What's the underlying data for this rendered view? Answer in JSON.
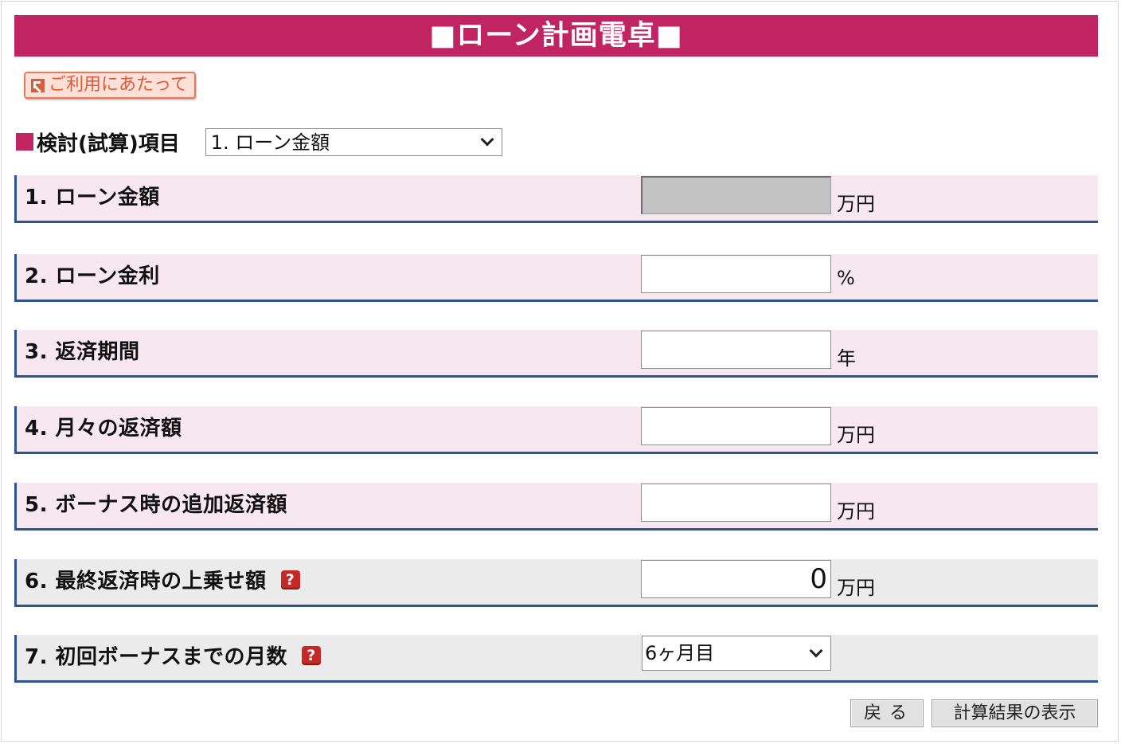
{
  "header": {
    "title": "■ローン計画電卓■"
  },
  "guide_link": {
    "label": "ご利用にあたって"
  },
  "calc_target": {
    "label": "検討(試算)項目",
    "selected": "1. ローン金額"
  },
  "rows": [
    {
      "label": "1. ローン金額",
      "value": "",
      "unit": "万円",
      "disabled": true
    },
    {
      "label": "2. ローン金利",
      "value": "",
      "unit": "%"
    },
    {
      "label": "3. 返済期間",
      "value": "",
      "unit": "年"
    },
    {
      "label": "4. 月々の返済額",
      "value": "",
      "unit": "万円"
    },
    {
      "label": "5. ボーナス時の追加返済額",
      "value": "",
      "unit": "万円"
    },
    {
      "label": "6. 最終返済時の上乗せ額",
      "value": "0",
      "unit": "万円",
      "help": "?"
    },
    {
      "label": "7. 初回ボーナスまでの月数",
      "selected": "6ヶ月目",
      "help": "?"
    }
  ],
  "buttons": {
    "back": "戻る",
    "show_result": "計算結果の表示"
  },
  "colors": {
    "brand": "#c02462",
    "row_pink": "#f7e7ef",
    "row_gray": "#ebebeb",
    "row_border": "#2f5293",
    "help_icon": "#c62828"
  }
}
